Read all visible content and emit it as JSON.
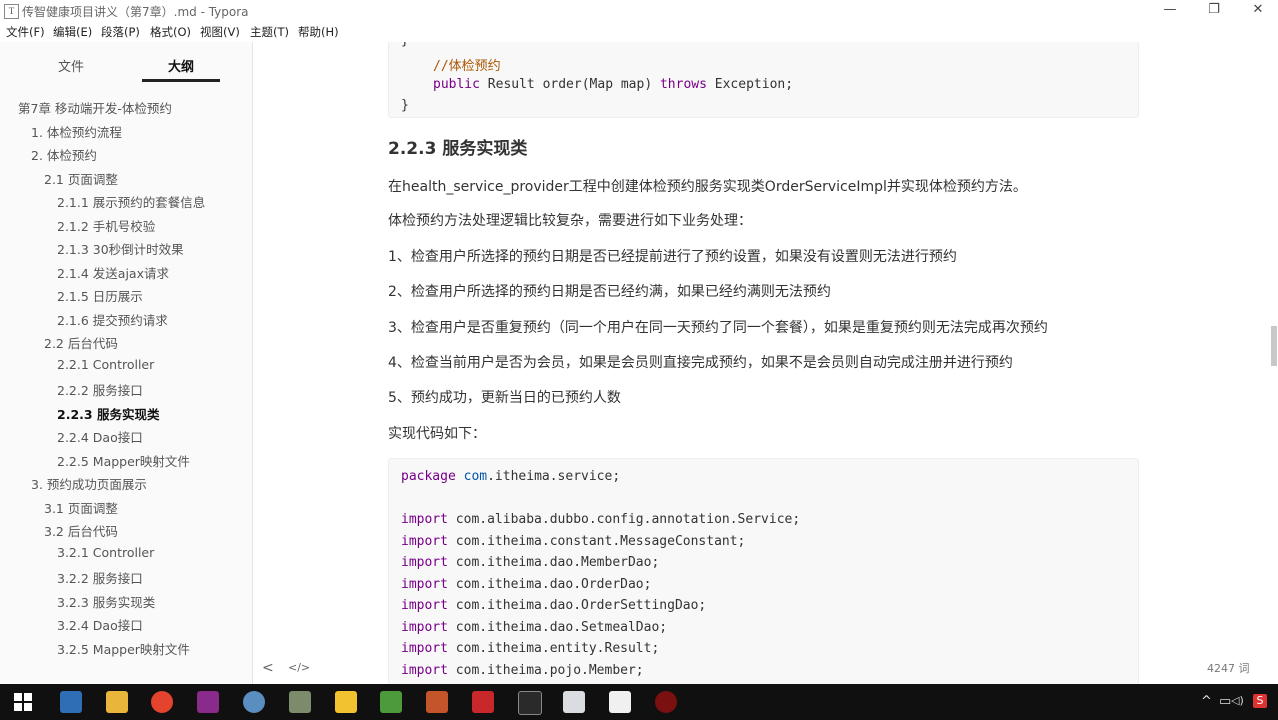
{
  "window": {
    "title": "传智健康项目讲义（第7章）.md - Typora",
    "app_icon": "T",
    "minimize": "—",
    "restore": "❐",
    "close": "✕"
  },
  "menu": [
    "文件(F)",
    "编辑(E)",
    "段落(P)",
    "格式(O)",
    "视图(V)",
    "主题(T)",
    "帮助(H)"
  ],
  "sidebar": {
    "tabs": [
      "文件",
      "大纲"
    ],
    "outline": [
      {
        "label": "第7章 移动端开发-体检预约",
        "level": 0
      },
      {
        "label": "1. 体检预约流程",
        "level": 1
      },
      {
        "label": "2. 体检预约",
        "level": 1
      },
      {
        "label": "2.1 页面调整",
        "level": 2
      },
      {
        "label": "2.1.1 展示预约的套餐信息",
        "level": 3
      },
      {
        "label": "2.1.2 手机号校验",
        "level": 3
      },
      {
        "label": "2.1.3 30秒倒计时效果",
        "level": 3
      },
      {
        "label": "2.1.4 发送ajax请求",
        "level": 3
      },
      {
        "label": "2.1.5 日历展示",
        "level": 3
      },
      {
        "label": "2.1.6 提交预约请求",
        "level": 3
      },
      {
        "label": "2.2 后台代码",
        "level": 2
      },
      {
        "label": "2.2.1 Controller",
        "level": 3
      },
      {
        "label": "2.2.2 服务接口",
        "level": 3
      },
      {
        "label": "2.2.3 服务实现类",
        "level": 3,
        "active": true
      },
      {
        "label": "2.2.4 Dao接口",
        "level": 3
      },
      {
        "label": "2.2.5 Mapper映射文件",
        "level": 3
      },
      {
        "label": "3. 预约成功页面展示",
        "level": 1
      },
      {
        "label": "3.1 页面调整",
        "level": 2
      },
      {
        "label": "3.2 后台代码",
        "level": 2
      },
      {
        "label": "3.2.1 Controller",
        "level": 3
      },
      {
        "label": "3.2.2 服务接口",
        "level": 3
      },
      {
        "label": "3.2.3 服务实现类",
        "level": 3
      },
      {
        "label": "3.2.4 Dao接口",
        "level": 3
      },
      {
        "label": "3.2.5 Mapper映射文件",
        "level": 3
      }
    ],
    "back_button": "<",
    "source_toggle": "</>"
  },
  "editor": {
    "code_top": {
      "brace_open": "}",
      "comment": "//体检预约",
      "kw_public": "public",
      "signature": " Result order(Map map) ",
      "kw_throws": "throws",
      "tail": " Exception;",
      "brace_close": "}"
    },
    "heading": "2.2.3 服务实现类",
    "paragraphs": [
      "在health_service_provider工程中创建体检预约服务实现类OrderServiceImpl并实现体检预约方法。",
      "体检预约方法处理逻辑比较复杂，需要进行如下业务处理：",
      "1、检查用户所选择的预约日期是否已经提前进行了预约设置，如果没有设置则无法进行预约",
      "2、检查用户所选择的预约日期是否已经约满，如果已经约满则无法预约",
      "3、检查用户是否重复预约（同一个用户在同一天预约了同一个套餐），如果是重复预约则无法完成再次预约",
      "4、检查当前用户是否为会员，如果是会员则直接完成预约，如果不是会员则自动完成注册并进行预约",
      "5、预约成功，更新当日的已预约人数",
      "实现代码如下："
    ],
    "code_main": {
      "package_kw": "package",
      "package_name": "com",
      "package_rest": ".itheima.service;",
      "imports": [
        " com.alibaba.dubbo.config.annotation.Service;",
        " com.itheima.constant.MessageConstant;",
        " com.itheima.dao.MemberDao;",
        " com.itheima.dao.OrderDao;",
        " com.itheima.dao.OrderSettingDao;",
        " com.itheima.dao.SetmealDao;",
        " com.itheima.entity.Result;",
        " com.itheima.pojo.Member;"
      ],
      "import_kw": "import"
    },
    "word_count": "4247 词"
  },
  "taskbar": {
    "icons": [
      "windows-start-icon",
      "file-explorer-icon",
      "folder-icon",
      "chrome-icon",
      "intellij-icon",
      "app-icon",
      "image-viewer-icon",
      "sticky-notes-icon",
      "notepad-plus-icon",
      "tool-icon",
      "redis-icon",
      "terminal-icon",
      "window-app-icon",
      "typora-icon",
      "recorder-icon"
    ],
    "tray": [
      "^",
      "▭",
      "◁)",
      "S"
    ]
  },
  "colors": {
    "keyword": "#770088",
    "comment": "#aa5500",
    "variable": "#0055aa",
    "taskbar": "#101010"
  }
}
